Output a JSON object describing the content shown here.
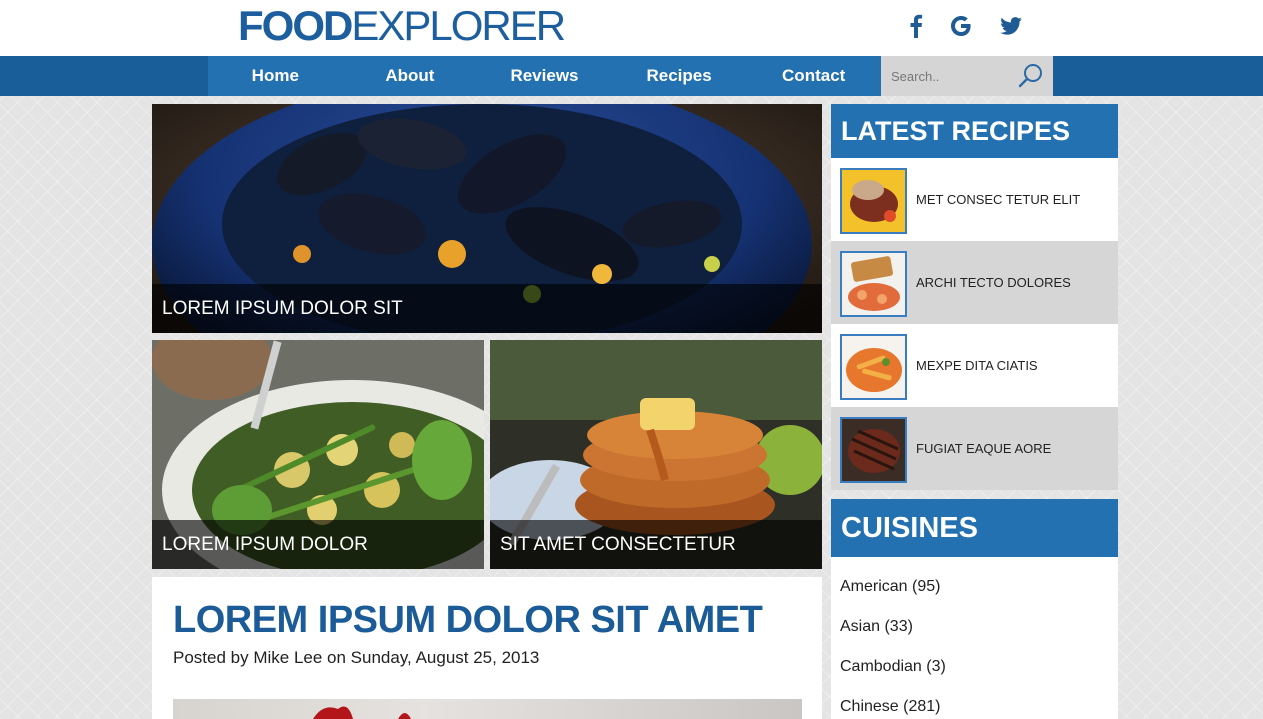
{
  "header": {
    "logo_bold": "FOOD",
    "logo_light": "EXPLORER",
    "social": [
      {
        "icon": "facebook-icon",
        "glyph": "f"
      },
      {
        "icon": "google-icon",
        "glyph": "G"
      },
      {
        "icon": "twitter-icon",
        "glyph": "twitter"
      }
    ]
  },
  "nav": {
    "items": [
      "Home",
      "About",
      "Reviews",
      "Recipes",
      "Contact"
    ],
    "search_placeholder": "Search..",
    "search_icon": "search-icon"
  },
  "featured": {
    "main_caption": "LOREM IPSUM DOLOR SIT",
    "left_caption": "LOREM IPSUM DOLOR",
    "right_caption": "SIT AMET CONSECTETUR"
  },
  "article": {
    "title": "LOREM IPSUM DOLOR SIT AMET",
    "meta": "Posted by Mike Lee on Sunday, August 25, 2013"
  },
  "sidebar": {
    "latest_title": "LATEST RECIPES",
    "recipes": [
      {
        "label": "MET CONSEC TETUR ELIT"
      },
      {
        "label": "ARCHI TECTO DOLORES"
      },
      {
        "label": "MEXPE DITA CIATIS"
      },
      {
        "label": "FUGIAT EAQUE AORE"
      }
    ],
    "cuisines_title": "CUISINES",
    "cuisines": [
      {
        "label": "American (95)"
      },
      {
        "label": "Asian (33)"
      },
      {
        "label": "Cambodian (3)"
      },
      {
        "label": "Chinese (281)"
      }
    ]
  },
  "colors": {
    "brand_blue": "#2371b1",
    "nav_dark": "#1a5e99",
    "title_blue": "#1a5b98"
  }
}
